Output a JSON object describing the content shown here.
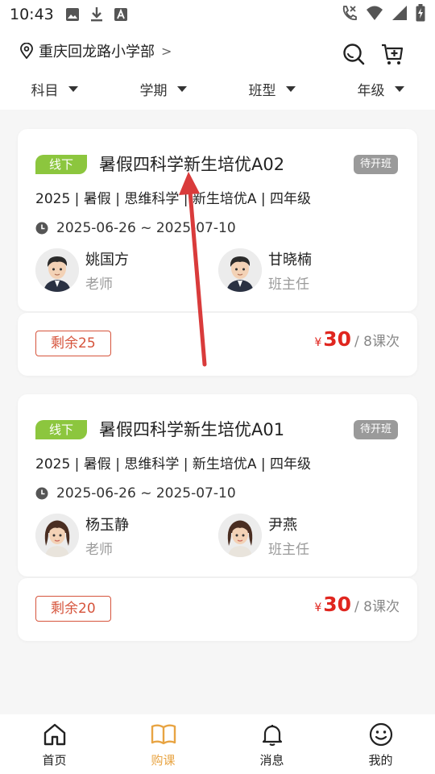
{
  "status_bar": {
    "time": "10:43",
    "left_icons": [
      "image-icon",
      "download-icon",
      "font-icon"
    ],
    "right_icons": [
      "call-icon",
      "wifi-icon",
      "signal-icon",
      "battery-icon"
    ]
  },
  "header": {
    "location": "重庆回龙路小学部",
    "location_chevron": ">",
    "filters": [
      {
        "label": "科目"
      },
      {
        "label": "学期"
      },
      {
        "label": "班型"
      },
      {
        "label": "年级"
      }
    ]
  },
  "colors": {
    "accent": "#e8a443",
    "offline_tag": "#8cc63e",
    "price": "#e0261f",
    "remain": "#d6543c",
    "status_badge": "#9a9a9a",
    "annotation_arrow": "#d93b3b"
  },
  "courses": [
    {
      "tag": "线下",
      "title": "暑假四科学新生培优A02",
      "status": "待开班",
      "meta": "2025 | 暑假 | 思维科学 | 新生培优A | 四年级",
      "date_range": "2025-06-26 ~ 2025-07-10",
      "teacher": {
        "name": "姚国方",
        "role": "老师",
        "avatar": "male-avatar-icon"
      },
      "head_teacher": {
        "name": "甘晓楠",
        "role": "班主任",
        "avatar": "male-avatar-icon"
      },
      "remaining": "剩余25",
      "price_currency": "¥",
      "price": "30",
      "price_unit": "/ 8课次"
    },
    {
      "tag": "线下",
      "title": "暑假四科学新生培优A01",
      "status": "待开班",
      "meta": "2025 | 暑假 | 思维科学 | 新生培优A | 四年级",
      "date_range": "2025-06-26 ~ 2025-07-10",
      "teacher": {
        "name": "杨玉静",
        "role": "老师",
        "avatar": "female-avatar-icon"
      },
      "head_teacher": {
        "name": "尹燕",
        "role": "班主任",
        "avatar": "female-avatar-icon"
      },
      "remaining": "剩余20",
      "price_currency": "¥",
      "price": "30",
      "price_unit": "/ 8课次"
    }
  ],
  "bottom_nav": [
    {
      "label": "首页",
      "icon": "home-icon",
      "active": false
    },
    {
      "label": "购课",
      "icon": "book-icon",
      "active": true
    },
    {
      "label": "消息",
      "icon": "bell-icon",
      "active": false
    },
    {
      "label": "我的",
      "icon": "smile-icon",
      "active": false
    }
  ]
}
